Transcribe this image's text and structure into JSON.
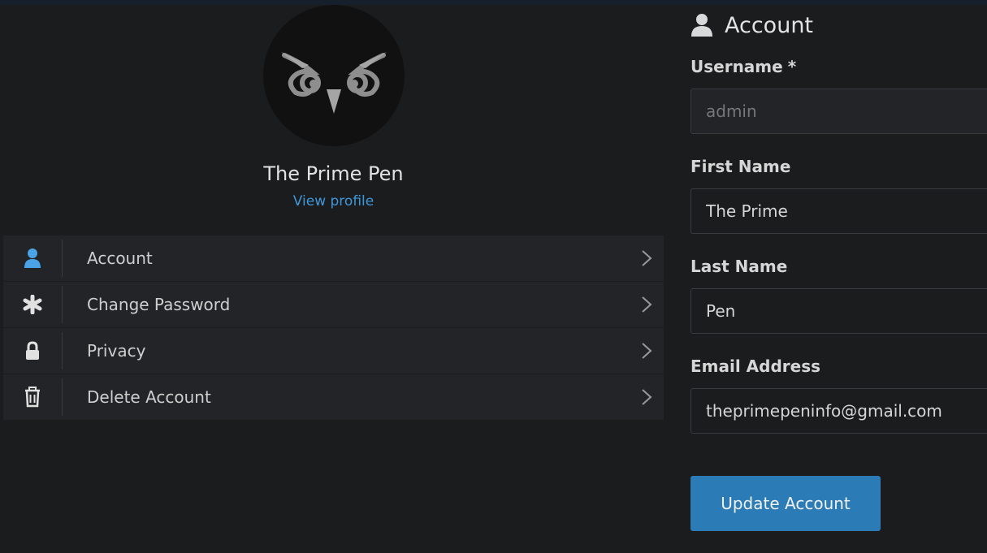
{
  "profile": {
    "name": "The Prime Pen",
    "view_link": "View profile"
  },
  "menu": {
    "items": [
      {
        "label": "Account",
        "icon": "user-icon",
        "active": true
      },
      {
        "label": "Change Password",
        "icon": "asterisk-icon"
      },
      {
        "label": "Privacy",
        "icon": "lock-icon"
      },
      {
        "label": "Delete Account",
        "icon": "trash-icon"
      }
    ]
  },
  "form": {
    "title": "Account",
    "username": {
      "label": "Username",
      "required_mark": "*",
      "value": "admin"
    },
    "first_name": {
      "label": "First Name",
      "value": "The Prime"
    },
    "last_name": {
      "label": "Last Name",
      "value": "Pen"
    },
    "email": {
      "label": "Email Address",
      "value": "theprimepeninfo@gmail.com"
    },
    "submit_label": "Update Account"
  },
  "colors": {
    "accent": "#2a7bb6",
    "link": "#3e97d9",
    "background": "#1b1c1e",
    "panel": "#232427"
  }
}
